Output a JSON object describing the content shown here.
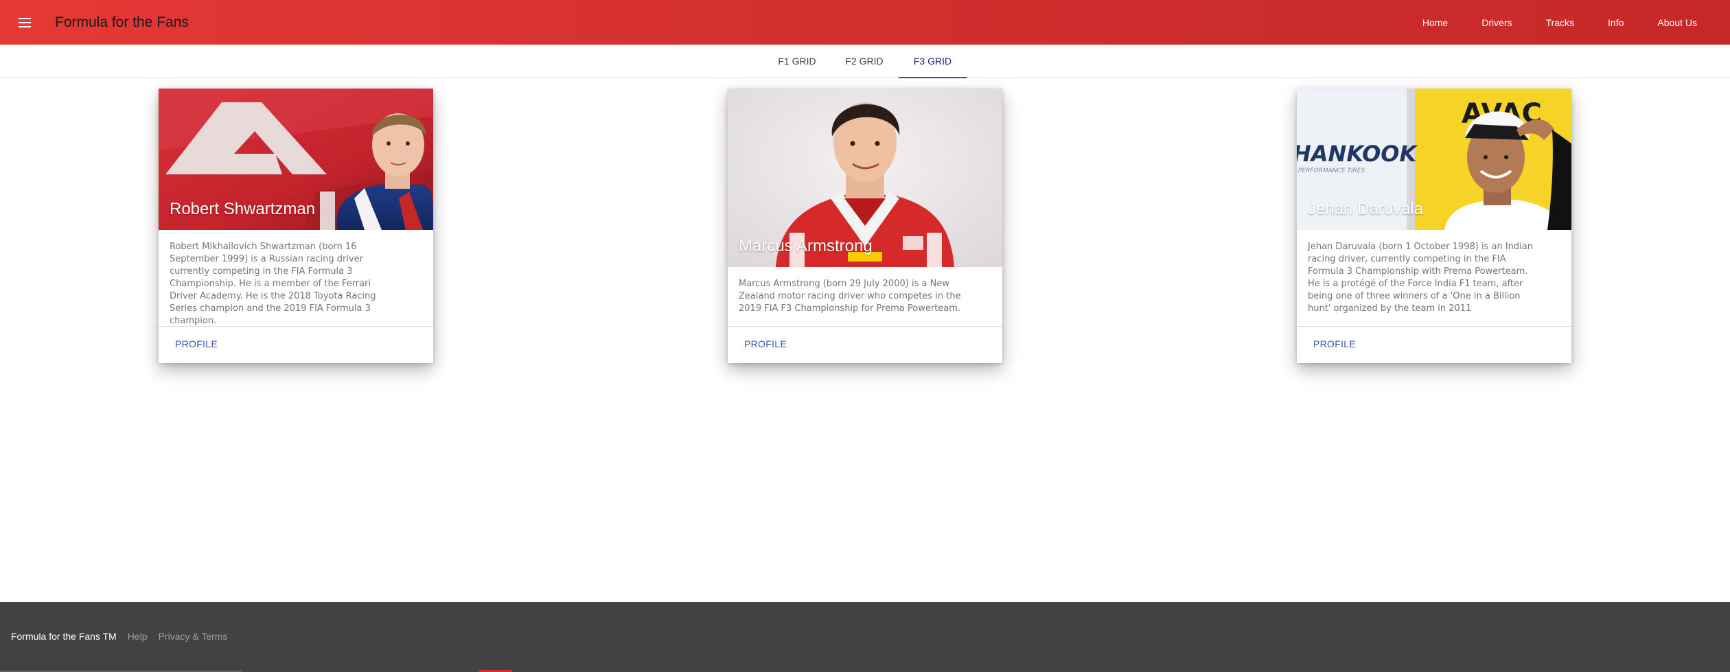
{
  "header": {
    "title": "Formula for the Fans",
    "menu_icon": "hamburger-menu-icon",
    "nav": [
      "Home",
      "Drivers",
      "Tracks",
      "Info",
      "About Us"
    ]
  },
  "tabs": [
    {
      "label": "F1 GRID",
      "active": false
    },
    {
      "label": "F2 GRID",
      "active": false
    },
    {
      "label": "F3 GRID",
      "active": true
    }
  ],
  "cards": [
    {
      "name": "Robert Shwartzman",
      "description": "Robert Mikhailovich Shwartzman (born 16 September 1999) is a Russian racing driver currently competing in the FIA Formula 3 Championship. He is a member of the Ferrari Driver Academy. He is the 2018 Toyota Racing Series champion and the 2019 FIA Formula 3 champion.",
      "action": "PROFILE"
    },
    {
      "name": "Marcus Armstrong",
      "description": "Marcus Armstrong (born 29 July 2000) is a New Zealand motor racing driver who competes in the 2019 FIA F3 Championship for Prema Powerteam.",
      "action": "PROFILE"
    },
    {
      "name": "Jehan Daruvala",
      "description": "Jehan Daruvala (born 1 October 1998) is an Indian racing driver, currently competing in the FIA Formula 3 Championship with Prema Powerteam. He is a protégé of the Force India F1 team, after being one of three winners of a 'One in a Billion hunt' organized by the team in 2011",
      "action": "PROFILE"
    }
  ],
  "photo_texts": {
    "sponsor1": "HANKOOK",
    "sponsor1_sub": "PERFORMANCE TIRES",
    "sponsor2": "AVAC"
  },
  "footer": {
    "brand": "Formula for the Fans TM",
    "links": [
      "Help",
      "Privacy & Terms"
    ]
  },
  "colors": {
    "header_red": "#d32f2f",
    "tab_indicator": "#3949ab",
    "action_blue": "#3f51b5",
    "footer_bg": "#424242"
  }
}
